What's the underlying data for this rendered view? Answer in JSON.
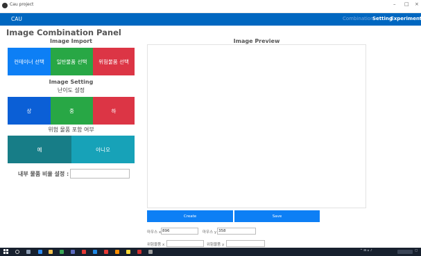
{
  "window": {
    "title": "Cau project"
  },
  "navbar": {
    "brand": "CAU",
    "links": [
      {
        "label": "Combination",
        "active": false
      },
      {
        "label": "Setting",
        "active": true
      },
      {
        "label": "Experiment",
        "active": true
      }
    ]
  },
  "panel": {
    "title": "Image Combination Panel"
  },
  "image_import": {
    "heading": "Image Import",
    "buttons": [
      {
        "label": "컨테이너 선택",
        "color": "#0d7ff5"
      },
      {
        "label": "일반물품 선택",
        "color": "#28a745"
      },
      {
        "label": "위험물품 선택",
        "color": "#dc3545"
      }
    ]
  },
  "image_setting": {
    "heading": "Image Setting",
    "difficulty_label": "난이도 설정",
    "difficulty_buttons": [
      {
        "label": "상",
        "color": "#0b5fd6"
      },
      {
        "label": "중",
        "color": "#28a745"
      },
      {
        "label": "하",
        "color": "#dc3545"
      }
    ],
    "danger_label": "위험 물품 포함 여부",
    "danger_buttons": [
      {
        "label": "예",
        "color": "#177d87"
      },
      {
        "label": "아니오",
        "color": "#17a2b8"
      }
    ],
    "ratio_label": "내부 물품 비율 설정 :",
    "ratio_value": ""
  },
  "preview": {
    "heading": "Image Preview",
    "create_label": "Create",
    "save_label": "Save",
    "mouse_x_label": "마우스 x",
    "mouse_x_value": "896",
    "mouse_y_label": "마우스 y",
    "mouse_y_value": "358",
    "danger_x_label": "위험물품 x",
    "danger_x_value": "",
    "danger_y_label": "위험물품 y",
    "danger_y_value": ""
  },
  "colors": {
    "navbar": "#0067c0",
    "primary": "#0d7ff5",
    "taskbar": "#17202e"
  }
}
